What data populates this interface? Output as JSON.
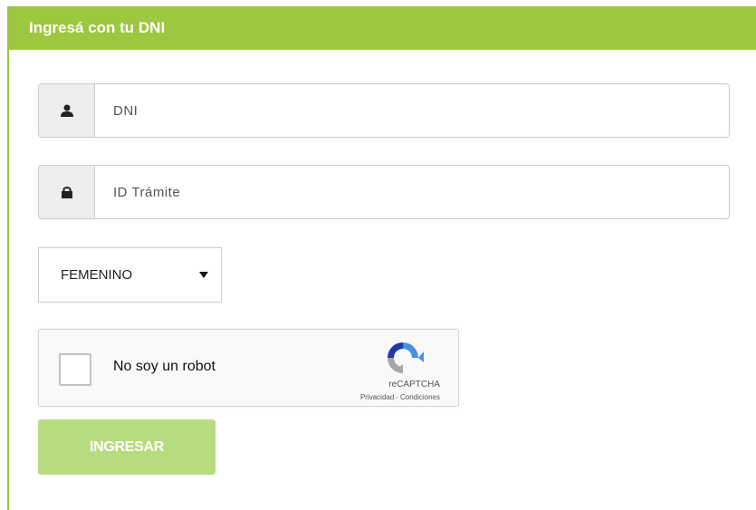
{
  "header": {
    "title": "Ingresá con tu DNI"
  },
  "form": {
    "dni": {
      "placeholder": "DNI",
      "icon": "user-icon"
    },
    "tramite": {
      "placeholder": "ID Trámite",
      "icon": "lock-icon"
    },
    "sex_select": {
      "value": "FEMENINO"
    },
    "recaptcha": {
      "label": "No soy un robot",
      "brand": "reCAPTCHA",
      "privacy": "Privacidad",
      "separator": "-",
      "terms": "Condiciones"
    },
    "submit_label": "INGRESAR"
  },
  "colors": {
    "accent": "#9cc73f",
    "button": "#b7dc80",
    "addon_bg": "#eeeeee"
  }
}
